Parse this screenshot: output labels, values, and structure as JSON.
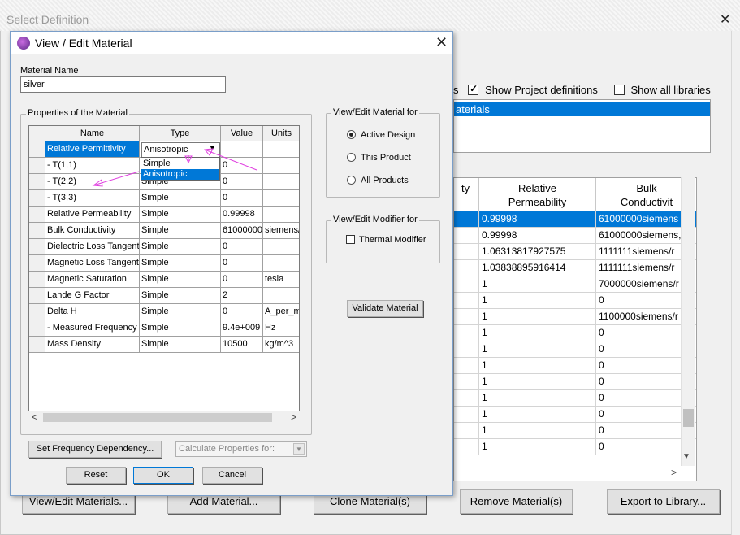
{
  "background_window": {
    "title": "Select Definition",
    "close_glyph": "✕",
    "show_project_definitions": "Show Project definitions",
    "show_all_libraries": "Show all libraries",
    "clipped_option_end": "s",
    "libraries_selected_item": "aterials",
    "grid": {
      "headers": [
        "ty",
        "Relative\nPermeability",
        "Bulk\nConductivit"
      ],
      "rows": [
        [
          "",
          "0.99998",
          "61000000siemens"
        ],
        [
          "",
          "0.99998",
          "61000000siemens,"
        ],
        [
          "",
          "1.06313817927575",
          "1111111siemens/r"
        ],
        [
          "",
          "1.03838895916414",
          "1111111siemens/r"
        ],
        [
          "",
          "1",
          "7000000siemens/r"
        ],
        [
          "",
          "1",
          "0"
        ],
        [
          "",
          "1",
          "1100000siemens/r"
        ],
        [
          "",
          "1",
          "0"
        ],
        [
          "",
          "1",
          "0"
        ],
        [
          "",
          "1",
          "0"
        ],
        [
          "",
          "1",
          "0"
        ],
        [
          "",
          "1",
          "0"
        ],
        [
          "",
          "1",
          "0"
        ],
        [
          "",
          "1",
          "0"
        ],
        [
          "",
          "1",
          "0"
        ]
      ]
    },
    "buttons": {
      "view_edit": "View/Edit Materials...",
      "add": "Add Material...",
      "clone": "Clone Material(s)",
      "remove": "Remove Material(s)",
      "export": "Export to Library..."
    }
  },
  "dialog": {
    "title": "View / Edit Material",
    "close_glyph": "✕",
    "material_name_label": "Material Name",
    "material_name_value": "silver",
    "properties_group_title": "Properties of the Material",
    "table": {
      "headers": [
        "Name",
        "Type",
        "Value",
        "Units"
      ],
      "rows": [
        [
          "Relative Permittivity",
          "Anisotropic",
          "",
          ""
        ],
        [
          "-  T(1,1)",
          "Simple",
          "0",
          ""
        ],
        [
          "-  T(2,2)",
          "Simple",
          "0",
          ""
        ],
        [
          "-  T(3,3)",
          "Simple",
          "0",
          ""
        ],
        [
          "Relative Permeability",
          "Simple",
          "0.99998",
          ""
        ],
        [
          "Bulk Conductivity",
          "Simple",
          "61000000",
          "siemens/"
        ],
        [
          "Dielectric Loss Tangent",
          "Simple",
          "0",
          ""
        ],
        [
          "Magnetic Loss Tangent",
          "Simple",
          "0",
          ""
        ],
        [
          "Magnetic Saturation",
          "Simple",
          "0",
          "tesla"
        ],
        [
          "Lande G Factor",
          "Simple",
          "2",
          ""
        ],
        [
          "Delta H",
          "Simple",
          "0",
          "A_per_m"
        ],
        [
          "-  Measured Frequency",
          "Simple",
          "9.4e+009",
          "Hz"
        ],
        [
          "Mass Density",
          "Simple",
          "10500",
          "kg/m^3"
        ]
      ]
    },
    "type_dropdown": {
      "current": "Anisotropic",
      "options": [
        "Simple",
        "Anisotropic"
      ],
      "highlighted": "Anisotropic"
    },
    "view_edit_for": {
      "title": "View/Edit Material for",
      "options": [
        "Active Design",
        "This Product",
        "All Products"
      ],
      "selected": "Active Design"
    },
    "modifier": {
      "title": "View/Edit Modifier for",
      "thermal_label": "Thermal Modifier"
    },
    "validate_button": "Validate Material",
    "set_freq_button": "Set Frequency Dependency...",
    "calc_props_placeholder": "Calculate Properties for:",
    "reset_button": "Reset",
    "ok_button": "OK",
    "cancel_button": "Cancel"
  },
  "colors": {
    "selection": "#0078d7",
    "annotation": "#e040e0"
  },
  "icons": [
    "app-icon",
    "close-icon",
    "dropdown-arrow-icon",
    "scroll-left-icon",
    "scroll-right-icon",
    "scroll-down-icon"
  ]
}
